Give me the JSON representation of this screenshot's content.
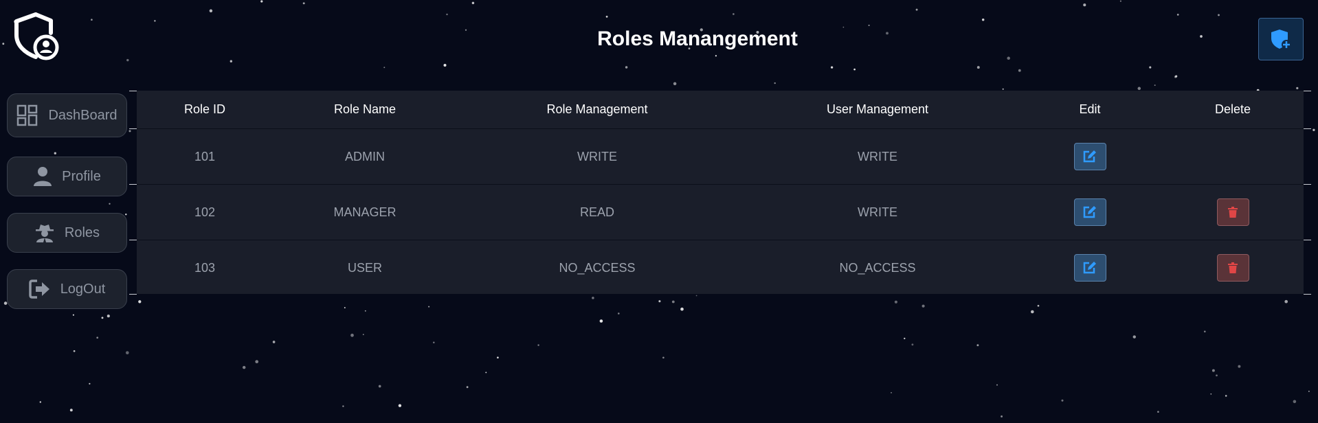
{
  "header": {
    "title": "Roles Manangement"
  },
  "sidebar": {
    "items": [
      {
        "label": "DashBoard",
        "icon": "dashboard-icon"
      },
      {
        "label": "Profile",
        "icon": "user-icon"
      },
      {
        "label": "Roles",
        "icon": "incognito-icon"
      },
      {
        "label": "LogOut",
        "icon": "logout-icon"
      }
    ]
  },
  "table": {
    "columns": [
      "Role ID",
      "Role Name",
      "Role Management",
      "User Management",
      "Edit",
      "Delete"
    ],
    "rows": [
      {
        "id": "101",
        "name": "ADMIN",
        "role_mgmt": "WRITE",
        "user_mgmt": "WRITE",
        "deletable": false
      },
      {
        "id": "102",
        "name": "MANAGER",
        "role_mgmt": "READ",
        "user_mgmt": "WRITE",
        "deletable": true
      },
      {
        "id": "103",
        "name": "USER",
        "role_mgmt": "NO_ACCESS",
        "user_mgmt": "NO_ACCESS",
        "deletable": true
      }
    ]
  },
  "colors": {
    "background": "#060a19",
    "edit_icon": "#2f9bff",
    "delete_icon": "#e04646",
    "add_icon": "#2f9bff"
  }
}
